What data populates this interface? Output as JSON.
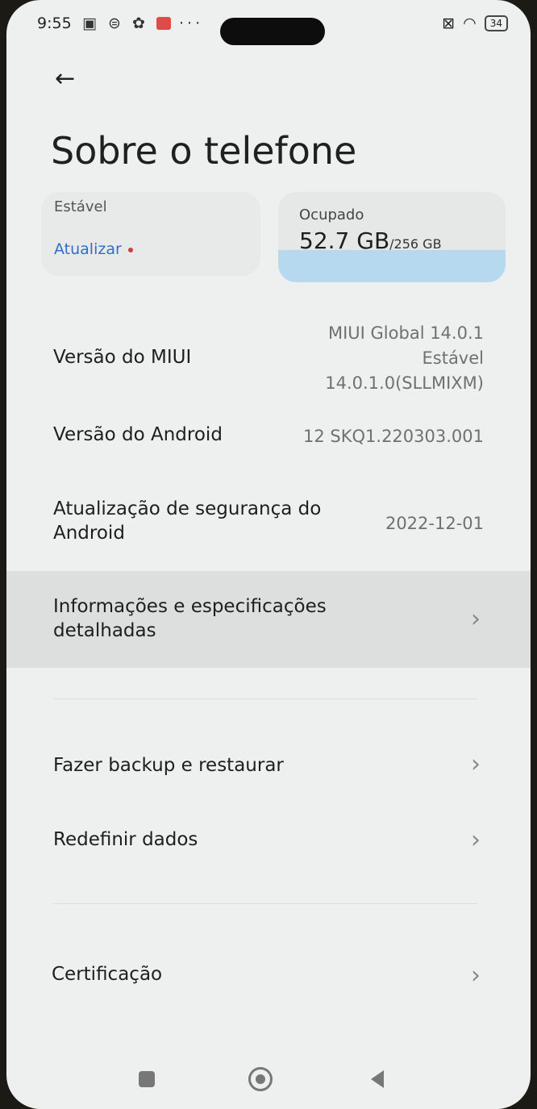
{
  "status_bar": {
    "time": "9:55",
    "icons_left": [
      "nfc-icon",
      "sim-icon",
      "gear-icon",
      "mail-icon",
      "more-dots-icon"
    ],
    "battery": "34"
  },
  "page": {
    "title": "Sobre o telefone"
  },
  "cards": {
    "update": {
      "channel": "Estável",
      "action": "Atualizar"
    },
    "storage": {
      "label": "Ocupado",
      "used": "52.7 GB",
      "total": "/256 GB",
      "used_fraction": 0.206
    }
  },
  "rows": [
    {
      "label": "Versão do MIUI",
      "value_lines": [
        "MIUI Global 14.0.1",
        "Estável",
        "14.0.1.0(SLLMIXM)"
      ]
    },
    {
      "label": "Versão do Android",
      "value": "12 SKQ1.220303.001"
    },
    {
      "label_lines": [
        "Atualização de segurança do",
        "Android"
      ],
      "value": "2022-12-01"
    },
    {
      "label_lines": [
        "Informações e especificações",
        "detalhadas"
      ]
    },
    {
      "label": "Fazer backup e restaurar"
    },
    {
      "label": "Redefinir dados"
    },
    {
      "label": "Certificação"
    }
  ],
  "glyphs": {
    "chevron": "›",
    "back": "←",
    "more": "···"
  },
  "colors": {
    "link": "#2f6fc4",
    "badge_dot": "#d23c3c",
    "storage_fill": "#b7d9f0"
  }
}
